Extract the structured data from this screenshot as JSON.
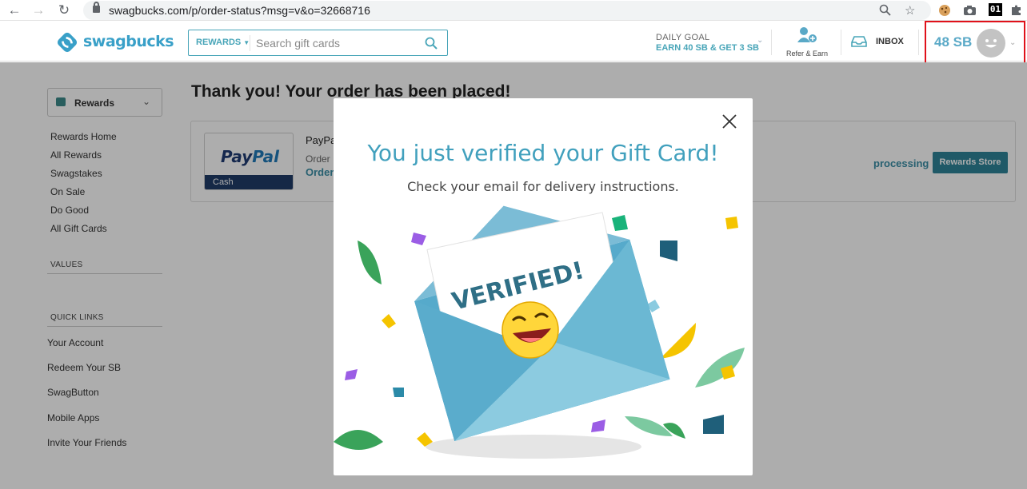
{
  "browser": {
    "url": "swagbucks.com/p/order-status?msg=v&o=32668716",
    "ext_badge": "01"
  },
  "header": {
    "logo_text": "swagbucks",
    "search": {
      "category": "REWARDS",
      "placeholder": "Search gift cards"
    },
    "daily_goal": {
      "title": "DAILY GOAL",
      "text": "EARN 40 SB & GET 3 SB"
    },
    "refer_label": "Refer & Earn",
    "inbox_label": "INBOX",
    "balance": "48 SB",
    "colors": {
      "accent": "#48a5b8",
      "highlight_box": "#e0111a"
    }
  },
  "sidebar": {
    "selector_label": "Rewards",
    "links": [
      "Rewards Home",
      "All Rewards",
      "Swagstakes",
      "On Sale",
      "Do Good",
      "All Gift Cards"
    ],
    "values_heading": "VALUES",
    "quick_links_heading": "QUICK LINKS",
    "quick_links": [
      "Your Account",
      "Redeem Your SB",
      "SwagButton",
      "Mobile Apps",
      "Invite Your Friends"
    ]
  },
  "main": {
    "title": "Thank you! Your order has been placed!",
    "order": {
      "card_brand": "PayPal",
      "card_label": "Cash",
      "title": "PayPa",
      "line2": "Order",
      "line3": "Order",
      "status": "processing",
      "store_button": "Rewards Store"
    }
  },
  "modal": {
    "title": "You just verified your Gift Card!",
    "subtitle": "Check your email for delivery instructions.",
    "stamp": "VERIFIED!"
  }
}
